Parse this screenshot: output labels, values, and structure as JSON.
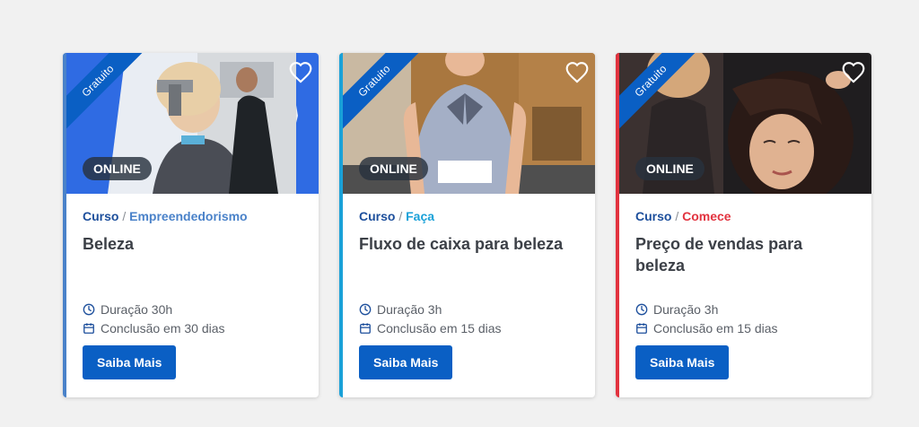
{
  "cards": [
    {
      "ribbon": "Gratuito",
      "badge": "ONLINE",
      "crumb_type": "Curso",
      "crumb_sep": "/",
      "crumb_category": "Empreendedorismo",
      "category_color": "#4a82c9",
      "accent_color": "#4a82c9",
      "title": "Beleza",
      "duration": "Duração 30h",
      "completion": "Conclusão em 30 dias",
      "button": "Saiba Mais"
    },
    {
      "ribbon": "Gratuito",
      "badge": "ONLINE",
      "crumb_type": "Curso",
      "crumb_sep": "/",
      "crumb_category": "Faça",
      "category_color": "#1aa1d8",
      "accent_color": "#1aa1d8",
      "title": "Fluxo de caixa para beleza",
      "duration": "Duração 3h",
      "completion": "Conclusão em 15 dias",
      "button": "Saiba Mais"
    },
    {
      "ribbon": "Gratuito",
      "badge": "ONLINE",
      "crumb_type": "Curso",
      "crumb_sep": "/",
      "crumb_category": "Comece",
      "category_color": "#e2333f",
      "accent_color": "#e2333f",
      "title": "Preço de vendas para beleza",
      "duration": "Duração 3h",
      "completion": "Conclusão em 15 dias",
      "button": "Saiba Mais"
    }
  ],
  "icons": {
    "favorite": "heart-outline-icon",
    "duration": "clock-icon",
    "completion": "calendar-icon"
  },
  "colors": {
    "primary_button": "#0a5fc4",
    "ribbon": "#0a5fc4",
    "crumb_type": "#1d4f9c"
  }
}
